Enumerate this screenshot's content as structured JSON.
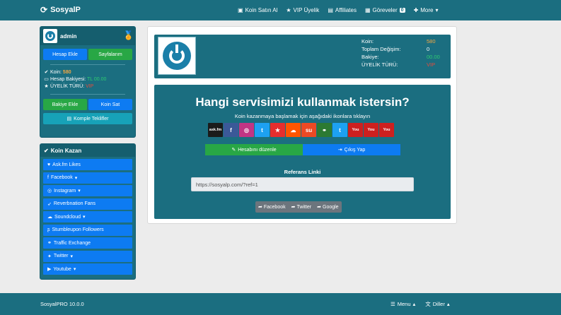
{
  "brand": {
    "icon": "refresh-icon",
    "name": "SosyalP"
  },
  "nav": {
    "items": [
      {
        "icon": "cash-register-icon",
        "label": "Koin Satın Al"
      },
      {
        "icon": "star-icon",
        "label": "VIP Üyelik"
      },
      {
        "icon": "list-icon",
        "label": "Affiliates"
      },
      {
        "icon": "briefcase-icon",
        "label": "Göreveler",
        "badge": "0"
      }
    ],
    "more": {
      "icon": "plus-icon",
      "label": "More"
    }
  },
  "user": {
    "name": "admin",
    "buttons": {
      "add_account": "Hesap Ekle",
      "pages": "Sayfalarım"
    },
    "stats": {
      "coin_label": "Koin:",
      "coin_value": "580",
      "balance_label": "Hesap Bakiyesi:",
      "balance_value": "TL 00.00",
      "membership_label": "ÜYELİK TÜRÜ:",
      "membership_value": "VIP"
    },
    "balance_add": "Bakiye Ekle",
    "coin_sell": "Koin Sat",
    "all_offers": "Komple Teklifler"
  },
  "earn": {
    "title": "Koin Kazan",
    "items": [
      {
        "icon": "heart-icon",
        "label": "Ask.fm Likes",
        "dropdown": false
      },
      {
        "icon": "facebook-icon",
        "label": "Facebook",
        "dropdown": true
      },
      {
        "icon": "instagram-icon",
        "label": "Instagram",
        "dropdown": true
      },
      {
        "icon": "rocket-icon",
        "label": "Reverbnation Fans",
        "dropdown": false
      },
      {
        "icon": "cloud-icon",
        "label": "Soundcloud",
        "dropdown": true
      },
      {
        "icon": "stumbleupon-icon",
        "label": "Stumbleupon Followers",
        "dropdown": false
      },
      {
        "icon": "link-icon",
        "label": "Traffic Exchange",
        "dropdown": false
      },
      {
        "icon": "twitter-icon",
        "label": "Twitter",
        "dropdown": true
      },
      {
        "icon": "youtube-icon",
        "label": "Youtube",
        "dropdown": true
      }
    ]
  },
  "profile": {
    "coin_label": "Koin:",
    "coin_value": "580",
    "total_change_label": "Toplam Değişim:",
    "total_change_value": "0",
    "balance_label": "Bakiye:",
    "balance_value": "00.00",
    "membership_label": "ÜYELİK TÜRÜ:",
    "membership_value": "VIP"
  },
  "service": {
    "title": "Hangi servisimizi kullanmak istersin?",
    "subtitle": "Koin kazanmaya başlamak için aşağıdaki ikonlara tıklayın",
    "icons": [
      {
        "name": "askfm-icon",
        "text": "ask.fm",
        "color": "#1b1b1b"
      },
      {
        "name": "facebook-icon",
        "text": "f",
        "color": "#3b5998"
      },
      {
        "name": "instagram-icon",
        "text": "◎",
        "color": "#c13584"
      },
      {
        "name": "twitter-icon",
        "text": "t",
        "color": "#1da1f2"
      },
      {
        "name": "reverbnation-icon",
        "text": "★",
        "color": "#e52e2e"
      },
      {
        "name": "soundcloud-icon",
        "text": "☁",
        "color": "#ff5500"
      },
      {
        "name": "stumbleupon-icon",
        "text": "su",
        "color": "#eb4924"
      },
      {
        "name": "traffic-icon",
        "text": "⚭",
        "color": "#2c7a32"
      },
      {
        "name": "twitter-icon-2",
        "text": "t",
        "color": "#1da1f2"
      },
      {
        "name": "youtube-icon",
        "text": "You",
        "color": "#cd201f"
      },
      {
        "name": "youtube-icon-2",
        "text": "You",
        "color": "#cd201f"
      },
      {
        "name": "youtube-icon-3",
        "text": "You",
        "color": "#cd201f"
      }
    ],
    "edit_account": "Hesabını düzenle",
    "logout": "Çıkış Yap",
    "ref_label": "Referans Linki",
    "ref_link": "https://sosyalp.com/?ref=1",
    "share": {
      "facebook": "Facebook",
      "twitter": "Twitter",
      "google": "Google"
    }
  },
  "footer": {
    "version": "SosyalPRO 10.0.0",
    "menu": "Menu",
    "languages": "Diller"
  },
  "colors": {
    "primary": "#1b6e80",
    "blue": "#0d7bf2",
    "green": "#28a745",
    "orange": "#f4a742",
    "red": "#e74c3c"
  }
}
